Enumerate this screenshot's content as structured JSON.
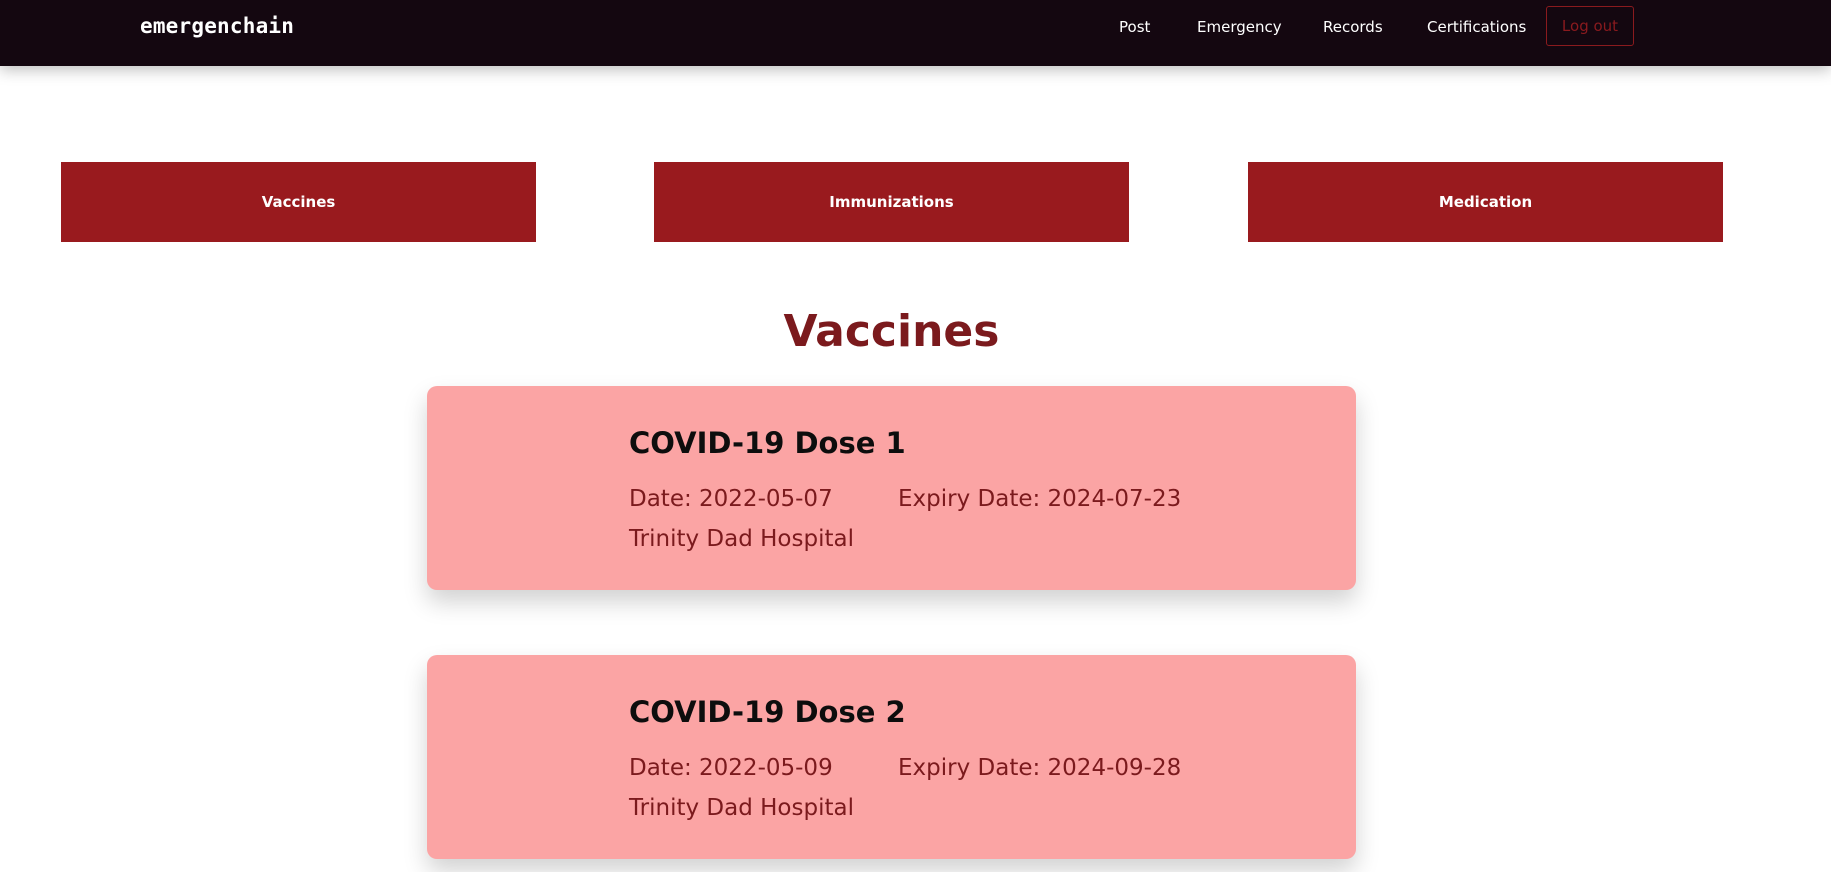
{
  "navbar": {
    "brand": "emergenchain",
    "links": [
      {
        "label": "Post"
      },
      {
        "label": "Emergency"
      },
      {
        "label": "Records"
      },
      {
        "label": "Certifications"
      }
    ],
    "logout_label": "Log out"
  },
  "tabs": [
    {
      "label": "Vaccines"
    },
    {
      "label": "Immunizations"
    },
    {
      "label": "Medication"
    }
  ],
  "section_title": "Vaccines",
  "vaccines": [
    {
      "name": "COVID-19 Dose 1",
      "date": "Date: 2022-05-07",
      "expiry": "Expiry Date: 2024-07-23",
      "hospital": "Trinity Dad Hospital"
    },
    {
      "name": "COVID-19 Dose 2",
      "date": "Date: 2022-05-09",
      "expiry": "Expiry Date: 2024-09-28",
      "hospital": "Trinity Dad Hospital"
    }
  ],
  "colors": {
    "navbar_bg": "#140710",
    "accent": "#991a1e",
    "heading": "#7b1a1d",
    "card_bg": "#fba4a4"
  }
}
